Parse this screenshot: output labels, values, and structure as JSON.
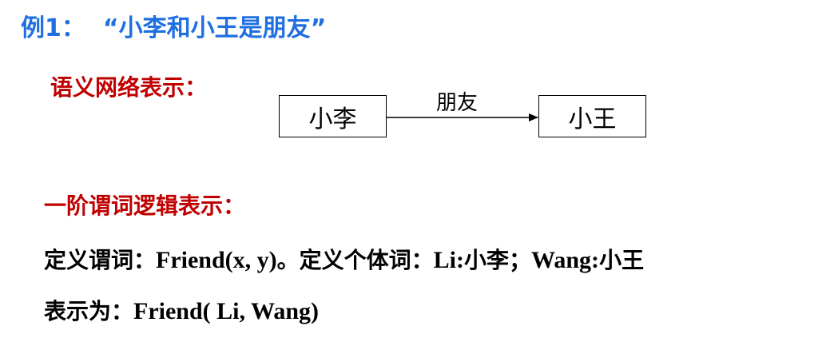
{
  "title": {
    "prefix": "例1：",
    "quote": "“小李和小王是朋友”"
  },
  "semantic_network": {
    "label": "语义网络表示：",
    "source_node": "小李",
    "target_node": "小王",
    "edge_label": "朋友"
  },
  "first_order_logic": {
    "label": "一阶谓词逻辑表示：",
    "line1": {
      "part1": "定义谓词：",
      "part2": "Friend(x, y)",
      "part3": "。定义个体词：",
      "part4": "Li:",
      "part5": "小李；",
      "part6": "Wang:",
      "part7": "小王"
    },
    "line2": {
      "part1": "表示为：",
      "part2": "Friend( Li, Wang)"
    }
  },
  "colors": {
    "title": "#1f6fe0",
    "section_label": "#c00000",
    "text": "#000000"
  }
}
